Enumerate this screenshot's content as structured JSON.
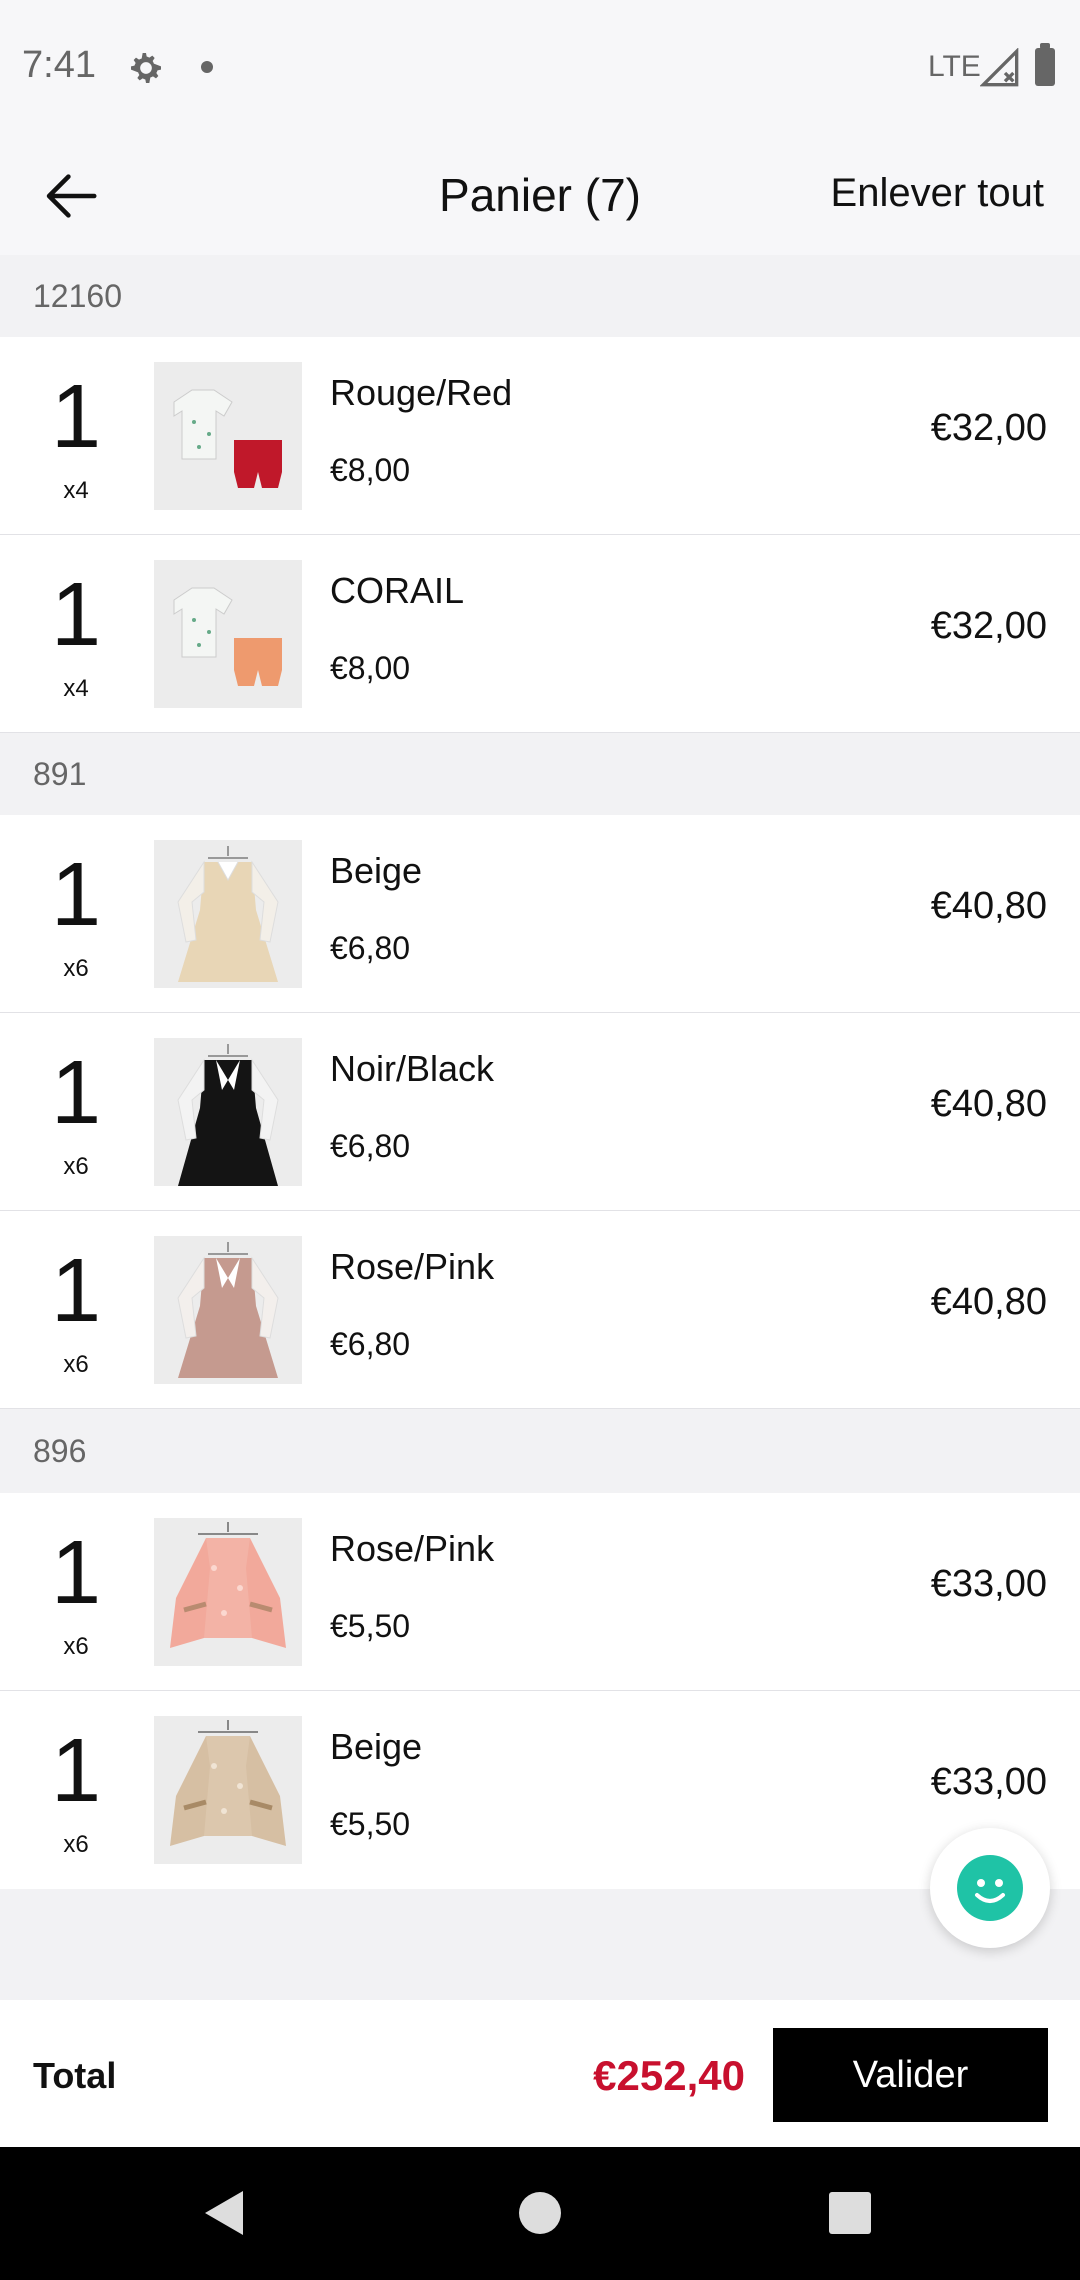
{
  "status": {
    "time": "7:41",
    "network": "LTE"
  },
  "header": {
    "title": "Panier (7)",
    "clear_all": "Enlever tout"
  },
  "groups": [
    {
      "ref": "12160",
      "items": [
        {
          "qty": "1",
          "mult": "x4",
          "name": "Rouge/Red",
          "unit_price": "€8,00",
          "line_total": "€32,00",
          "image": "shirt-shorts-red"
        },
        {
          "qty": "1",
          "mult": "x4",
          "name": "CORAIL",
          "unit_price": "€8,00",
          "line_total": "€32,00",
          "image": "shirt-shorts-coral"
        }
      ]
    },
    {
      "ref": "891",
      "items": [
        {
          "qty": "1",
          "mult": "x6",
          "name": "Beige",
          "unit_price": "€6,80",
          "line_total": "€40,80",
          "image": "dress-beige"
        },
        {
          "qty": "1",
          "mult": "x6",
          "name": "Noir/Black",
          "unit_price": "€6,80",
          "line_total": "€40,80",
          "image": "dress-black"
        },
        {
          "qty": "1",
          "mult": "x6",
          "name": "Rose/Pink",
          "unit_price": "€6,80",
          "line_total": "€40,80",
          "image": "dress-pink"
        }
      ]
    },
    {
      "ref": "896",
      "items": [
        {
          "qty": "1",
          "mult": "x6",
          "name": "Rose/Pink",
          "unit_price": "€5,50",
          "line_total": "€33,00",
          "image": "blouse-pink"
        },
        {
          "qty": "1",
          "mult": "x6",
          "name": "Beige",
          "unit_price": "€5,50",
          "line_total": "€33,00",
          "image": "blouse-beige"
        }
      ]
    }
  ],
  "footer": {
    "total_label": "Total",
    "total_value": "€252,40",
    "validate_label": "Valider"
  },
  "colors": {
    "accent_price": "#c8102e",
    "validate_bg": "#000000",
    "chat_fab": "#1fc3a6"
  }
}
